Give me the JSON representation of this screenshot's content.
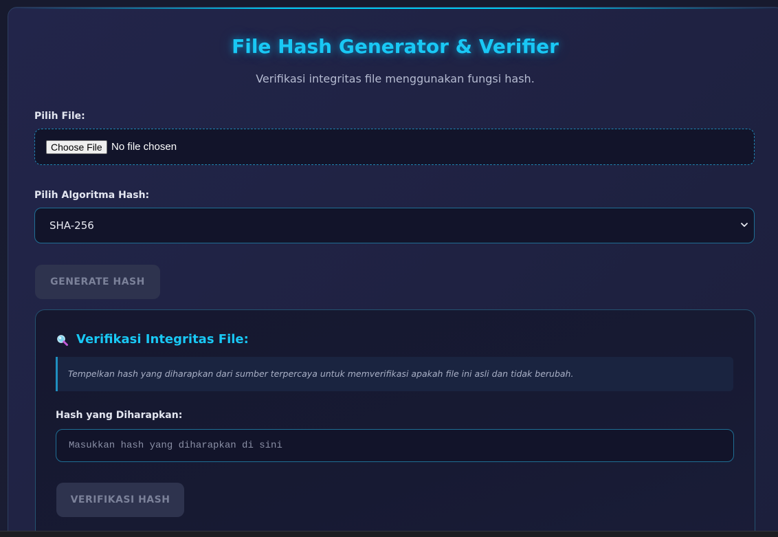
{
  "header": {
    "title": "File Hash Generator & Verifier",
    "subtitle": "Verifikasi integritas file menggunakan fungsi hash."
  },
  "file_picker": {
    "label": "Pilih File:",
    "button_label": "Choose File",
    "status_text": "No file chosen"
  },
  "algorithm": {
    "label": "Pilih Algoritma Hash:",
    "selected": "SHA-256"
  },
  "generate": {
    "button_label": "GENERATE HASH"
  },
  "verify": {
    "icon": "magnifier-icon",
    "heading": "Verifikasi Integritas File:",
    "note": "Tempelkan hash yang diharapkan dari sumber terpercaya untuk memverifikasi apakah file ini asli dan tidak berubah.",
    "input_label": "Hash yang Diharapkan:",
    "input_placeholder": "Masukkan hash yang diharapkan di sini",
    "input_value": "",
    "button_label": "VERIFIKASI HASH"
  },
  "colors": {
    "accent": "#19c8f5",
    "background": "#1f2242",
    "field_background": "#12142a",
    "disabled_button": "#2e334e"
  }
}
